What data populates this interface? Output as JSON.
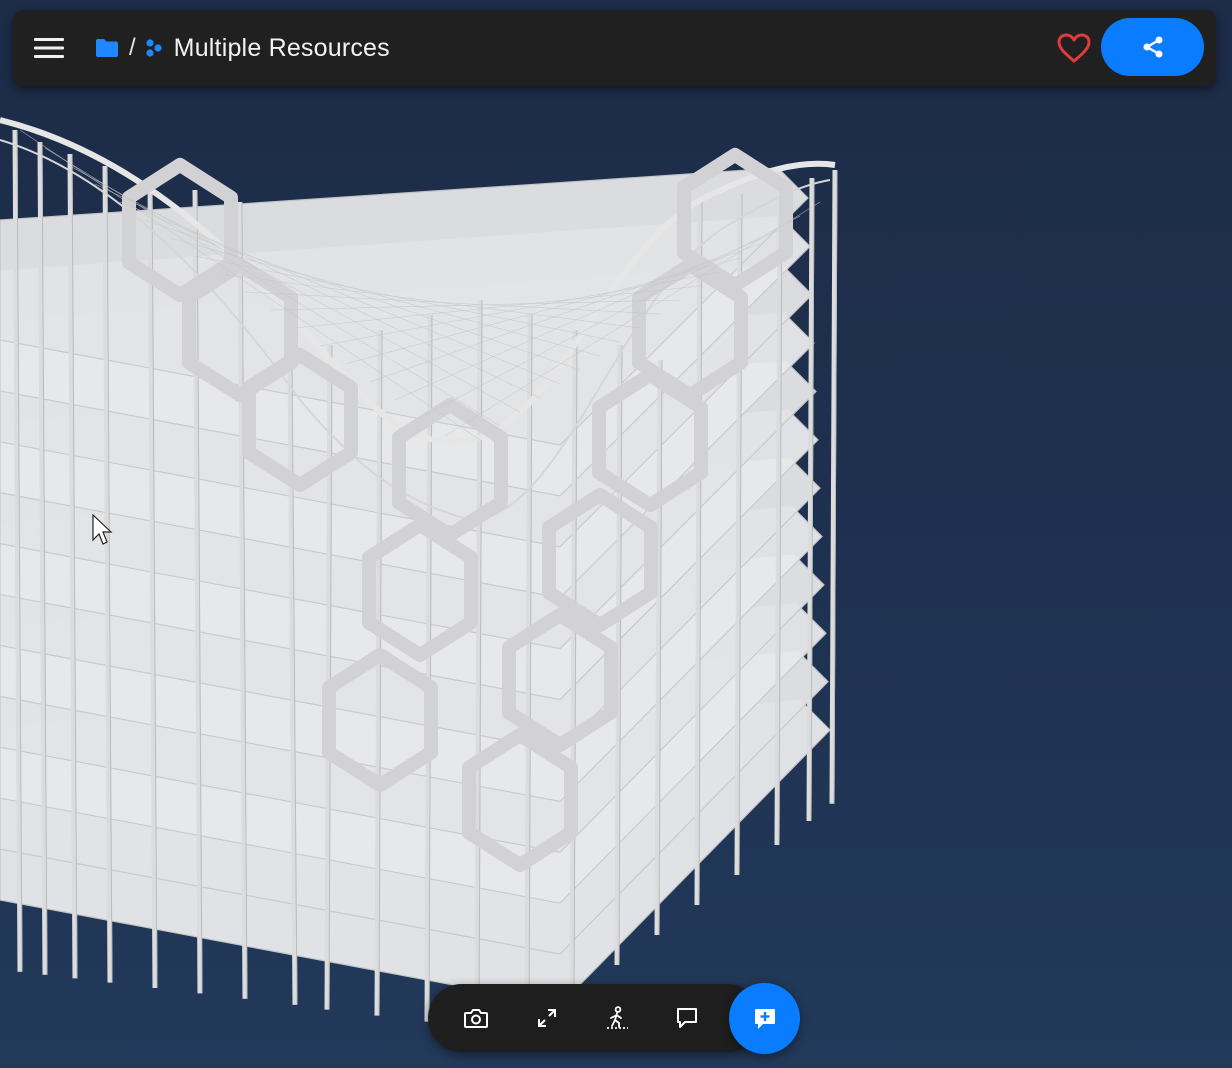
{
  "header": {
    "menu_icon": "hamburger-menu-icon",
    "folder_icon": "folder-icon",
    "separator": "/",
    "model_icon": "multiple-resources-icon",
    "title": "Multiple Resources",
    "favorite_icon": "heart-outline-icon",
    "share_icon": "share-icon"
  },
  "toolbar": {
    "items": [
      {
        "name": "screenshot-button",
        "icon": "camera-icon"
      },
      {
        "name": "fullscreen-button",
        "icon": "expand-arrows-icon"
      },
      {
        "name": "walk-mode-button",
        "icon": "person-walking-icon"
      },
      {
        "name": "comments-button",
        "icon": "speech-bubble-icon"
      }
    ],
    "add_comment_icon": "comment-plus-icon"
  },
  "colors": {
    "accent": "#0a7cff",
    "favorite": "#e0393e",
    "bar_background": "#202020",
    "viewport_background": "#1e3150",
    "model": "#e6e6e6"
  }
}
